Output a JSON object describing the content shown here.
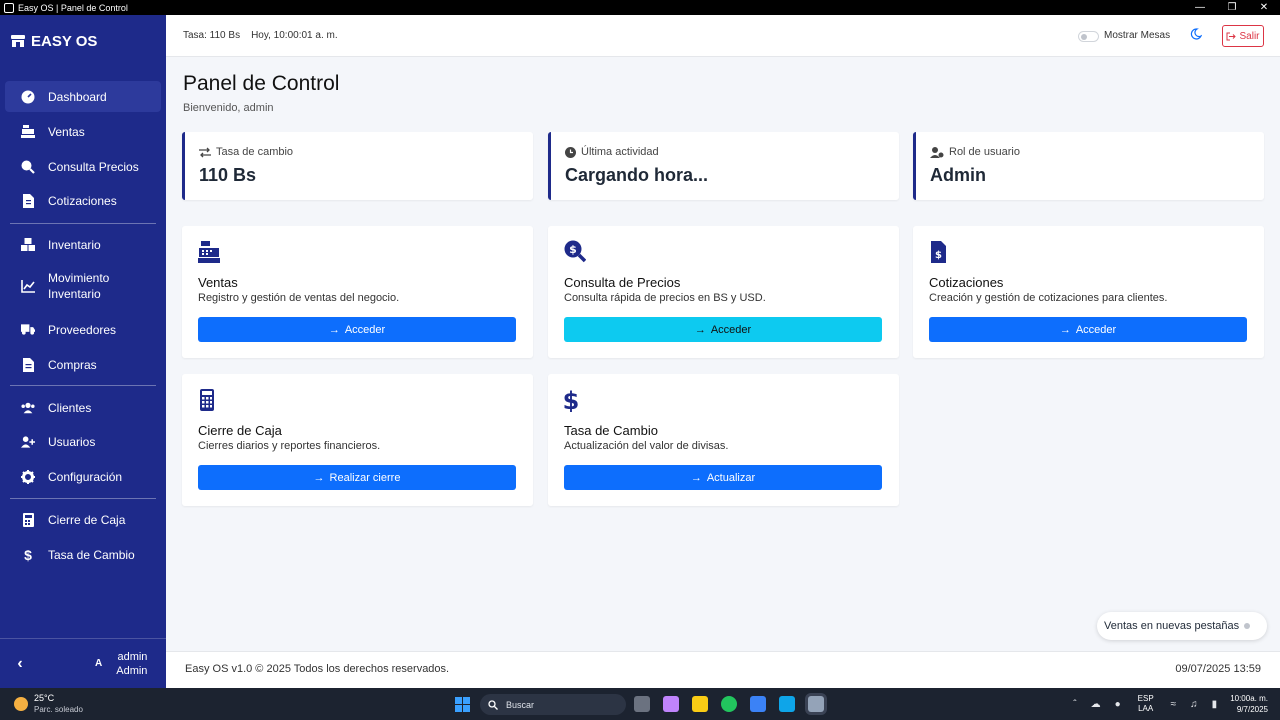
{
  "window": {
    "title": "Easy OS | Panel de Control",
    "controls": [
      "—",
      "❐",
      "✕"
    ]
  },
  "sidebar": {
    "brand": "EASY OS",
    "items": [
      {
        "label": "Dashboard",
        "icon": "gauge-icon",
        "active": true
      },
      {
        "label": "Ventas",
        "icon": "cash-register-icon"
      },
      {
        "label": "Consulta Precios",
        "icon": "search-dollar-icon"
      },
      {
        "label": "Cotizaciones",
        "icon": "file-invoice-icon"
      },
      {
        "label": "Inventario",
        "icon": "boxes-icon"
      },
      {
        "label": "Movimiento Inventario",
        "icon": "chart-line-icon"
      },
      {
        "label": "Proveedores",
        "icon": "truck-icon"
      },
      {
        "label": "Compras",
        "icon": "file-icon"
      },
      {
        "label": "Clientes",
        "icon": "users-icon"
      },
      {
        "label": "Usuarios",
        "icon": "user-plus-icon"
      },
      {
        "label": "Configuración",
        "icon": "gear-icon"
      },
      {
        "label": "Cierre de Caja",
        "icon": "calculator-icon"
      },
      {
        "label": "Tasa de Cambio",
        "icon": "dollar-icon"
      }
    ],
    "user_initial": "A",
    "user_name": "admin",
    "user_role": "Admin"
  },
  "topbar": {
    "rate": "Tasa: 110 Bs",
    "time": "Hoy, 10:00:01 a. m.",
    "toggle_label": "Mostrar Mesas",
    "logout": "Salir"
  },
  "main": {
    "title": "Panel de Control",
    "welcome": "Bienvenido, admin",
    "stats": [
      {
        "label": "Tasa de cambio",
        "value": "110 Bs",
        "icon": "exchange-icon"
      },
      {
        "label": "Última actividad",
        "value": "Cargando hora...",
        "icon": "clock-icon"
      },
      {
        "label": "Rol de usuario",
        "value": "Admin",
        "icon": "user-gear-icon"
      }
    ],
    "modules": [
      {
        "title": "Ventas",
        "desc": "Registro y gestión de ventas del negocio.",
        "button": "Acceder",
        "icon": "cash-register-icon"
      },
      {
        "title": "Consulta de Precios",
        "desc": "Consulta rápida de precios en BS y USD.",
        "button": "Acceder",
        "icon": "search-dollar-icon"
      },
      {
        "title": "Cotizaciones",
        "desc": "Creación y gestión de cotizaciones para clientes.",
        "button": "Acceder",
        "icon": "file-invoice-dollar-icon"
      },
      {
        "title": "Cierre de Caja",
        "desc": "Cierres diarios y reportes financieros.",
        "button": "Realizar cierre",
        "icon": "calculator-icon"
      },
      {
        "title": "Tasa de Cambio",
        "desc": "Actualización del valor de divisas.",
        "button": "Actualizar",
        "icon": "dollar-icon"
      }
    ],
    "new_tabs_label": "Ventas en nuevas pestañas"
  },
  "footer": {
    "left": "Easy OS v1.0 © 2025 Todos los derechos reservados.",
    "right": "09/07/2025 13:59"
  },
  "taskbar": {
    "temp": "25°C",
    "weather": "Parc. soleado",
    "search": "Buscar",
    "lang_1": "ESP",
    "lang_2": "LAA",
    "clock_time": "10:00a. m.",
    "clock_date": "9/7/2025"
  },
  "colors": {
    "sidebar": "#1e2a8a",
    "primary": "#0d6efd",
    "info": "#0dcaf0",
    "danger": "#dc3545"
  }
}
